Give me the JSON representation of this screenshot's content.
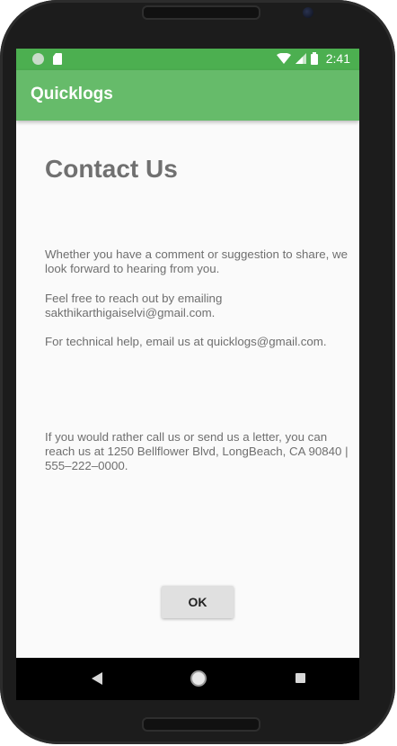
{
  "statusbar": {
    "time": "2:41"
  },
  "appbar": {
    "title": "Quicklogs"
  },
  "contact": {
    "heading": "Contact Us",
    "intro": "Whether you have a comment or suggestion to share, we look forward to hearing from you.",
    "email_line": "Feel free to reach out by emailing sakthikarthigaiselvi@gmail.com.",
    "tech_line": "For technical help, email us at quicklogs@gmail.com.",
    "address_line": "If you would rather call us or send us a letter, you can reach us at 1250 Bellflower Blvd, LongBeach, CA 90840 | 555–222–0000."
  },
  "dialog": {
    "ok_label": "OK"
  },
  "colors": {
    "status_bar": "#4caf50",
    "app_bar": "#66bb6a"
  },
  "icons": [
    "notification-icon",
    "sd-card-icon",
    "wifi-icon",
    "signal-icon",
    "battery-icon",
    "back-icon",
    "home-icon",
    "recents-icon"
  ]
}
